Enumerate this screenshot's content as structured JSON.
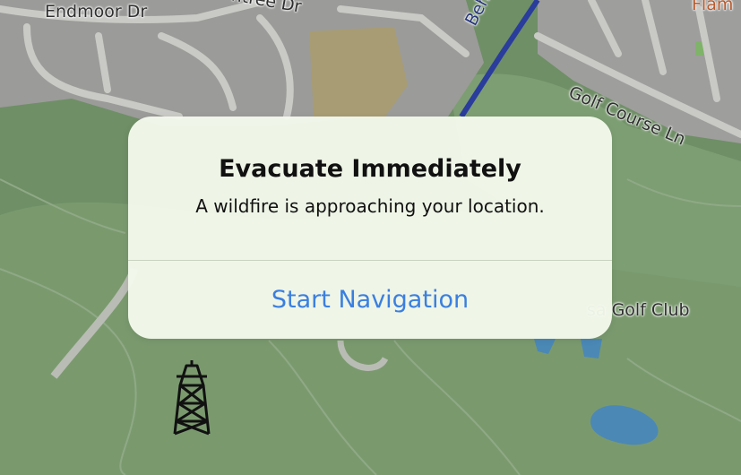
{
  "map": {
    "streets": {
      "endmoor": "Endmoor Dr",
      "cutoff": "ntree Dr",
      "road_blue": "Behnd Rd",
      "golf_course_ln": "Golf Course Ln",
      "golf_club": "sa Golf Club",
      "flam": "Flam"
    },
    "icons": {
      "tower": "power-tower-icon"
    }
  },
  "alert": {
    "title": "Evacuate Immediately",
    "message": "A wildfire is approaching your location.",
    "action_label": "Start Navigation",
    "accent_color": "#3a7fe0"
  }
}
